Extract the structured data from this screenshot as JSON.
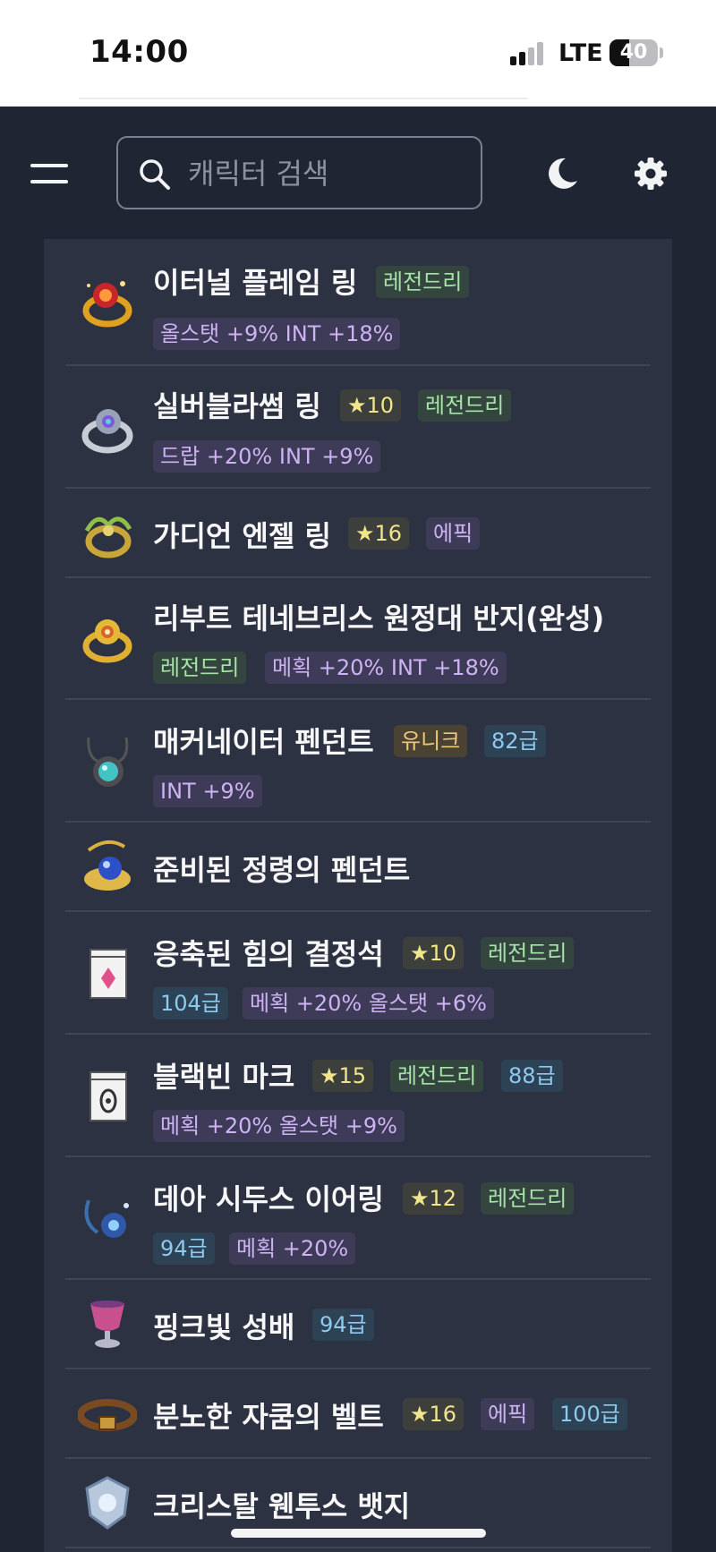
{
  "status_bar": {
    "time": "14:00",
    "network": "LTE",
    "battery": "40",
    "battery_level_percent": 40
  },
  "header": {
    "search_placeholder": "캐릭터 검색",
    "menu_icon": "menu-icon",
    "search_icon": "search-icon",
    "theme_icon": "moon-icon",
    "settings_icon": "gear-icon"
  },
  "colors": {
    "background": "#1f2532",
    "panel": "#2c3242",
    "legendary": "#a6e3a6",
    "epic": "#cdb3f2",
    "unique": "#f1c874",
    "level": "#8ec9ee",
    "star": "#f1e58c"
  },
  "items": [
    {
      "name": "이터널 플레임 링",
      "grade": "레전드리",
      "stats": "올스탯 +9% INT +18%"
    },
    {
      "name": "실버블라썸 링",
      "star": "10",
      "grade": "레전드리",
      "stats": "드랍 +20% INT +9%"
    },
    {
      "name": "가디언 엔젤 링",
      "star": "16",
      "grade": "에픽"
    },
    {
      "name": "리부트 테네브리스 원정대 반지(완성)",
      "grade": "레전드리",
      "stats": "메획 +20% INT +18%"
    },
    {
      "name": "매커네이터 펜던트",
      "grade": "유니크",
      "level": "82급",
      "stats": "INT +9%"
    },
    {
      "name": "준비된 정령의 펜던트"
    },
    {
      "name": "응축된 힘의 결정석",
      "star": "10",
      "grade": "레전드리",
      "level": "104급",
      "stats": "메획 +20% 올스탯 +6%"
    },
    {
      "name": "블랙빈 마크",
      "star": "15",
      "grade": "레전드리",
      "level": "88급",
      "stats": "메획 +20% 올스탯 +9%"
    },
    {
      "name": "데아 시두스 이어링",
      "star": "12",
      "grade": "레전드리",
      "level": "94급",
      "stats": "메획 +20%"
    },
    {
      "name": "핑크빛 성배",
      "level": "94급"
    },
    {
      "name": "분노한 자쿰의 벨트",
      "star": "16",
      "grade": "에픽",
      "level": "100급"
    },
    {
      "name": "크리스탈 웬투스 뱃지"
    }
  ]
}
